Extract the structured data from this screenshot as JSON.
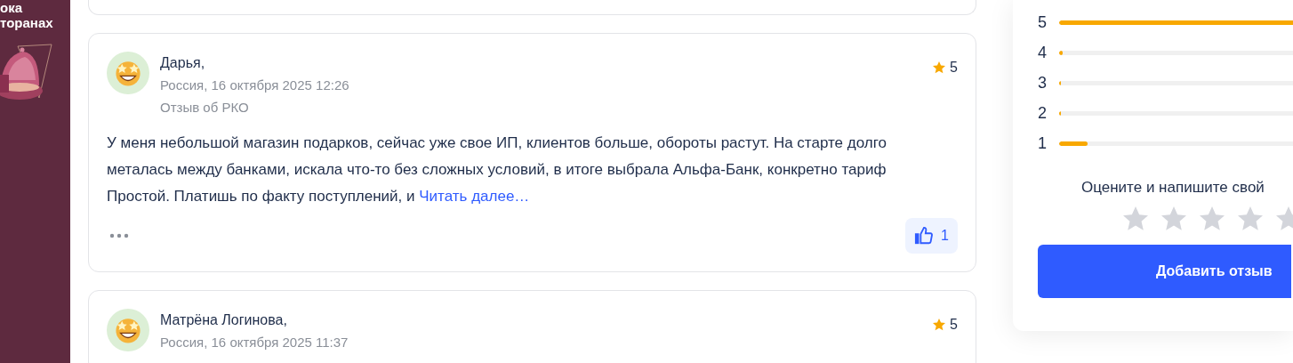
{
  "promo_banner": {
    "text_lines": [
      "ока",
      "торанах"
    ]
  },
  "reviews": [
    {
      "kind": "tail"
    },
    {
      "kind": "full",
      "author": "Дарья,",
      "meta": "Россия, 16 октября 2025 12:26",
      "topic": "Отзыв об РКО",
      "rating": "5",
      "body": "У меня небольшой магазин подарков, сейчас уже свое ИП, клиентов больше, обороты растут. На старте долго металась между банками, искала что-то без сложных условий, в итоге выбрала Альфа-Банк, конкретно тариф Простой. Платишь по факту поступлений, и",
      "read_more": "Читать далее…",
      "likes": "1"
    },
    {
      "kind": "full",
      "author": "Матрёна Логинова,",
      "meta": "Россия, 16 октября 2025 11:37",
      "rating": "5"
    }
  ],
  "rating_summary": {
    "rows": [
      {
        "label": "5",
        "level": 0.85
      },
      {
        "label": "4",
        "level": 0.01
      },
      {
        "label": "3",
        "level": 0.005
      },
      {
        "label": "2",
        "level": 0.005
      },
      {
        "label": "1",
        "level": 0.08
      }
    ],
    "prompt": "Оцените и напишите свой",
    "stars": 0,
    "submit": "Добавить отзыв"
  }
}
